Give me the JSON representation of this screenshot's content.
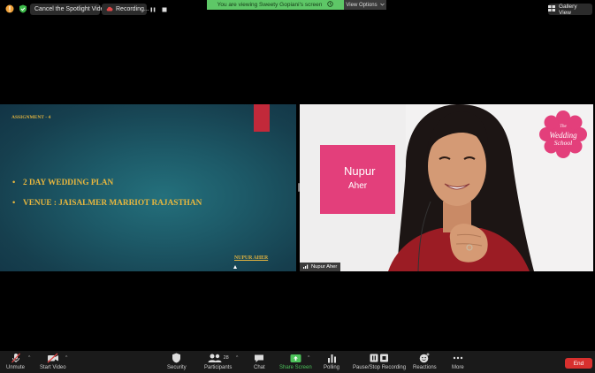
{
  "topbar": {
    "spotlight_label": "Cancel the Spotlight Video",
    "recording_label": "Recording...",
    "viewing_banner": "You are viewing Sweety Gopiani's screen",
    "view_options": "View Options",
    "gallery_view": "Gallery View"
  },
  "slide": {
    "heading": "ASSIGNMENT - 4",
    "bullet1": "2 DAY WEDDING PLAN",
    "bullet2": "VENUE : JAISALMER MARRIOT RAJASTHAN",
    "author": "NUPUR AHER",
    "bullet_symbol": "•"
  },
  "video": {
    "first_name": "Nupur",
    "last_name": "Aher",
    "logo_line1": "The",
    "logo_line2": "Wedding",
    "logo_line3": "School",
    "participant_name": "Nupur Aher"
  },
  "toolbar": {
    "unmute": "Unmute",
    "start_video": "Start Video",
    "security": "Security",
    "participants": "Participants",
    "participants_count": "28",
    "chat": "Chat",
    "share_screen": "Share Screen",
    "polling": "Polling",
    "recording": "Pause/Stop Recording",
    "reactions": "Reactions",
    "more": "More",
    "end": "End"
  },
  "colors": {
    "banner_green": "#5ec767",
    "slide_text_gold": "#e8b73e",
    "pink": "#e33f7b",
    "end_red": "#d8302e",
    "share_green": "#4cc25a"
  }
}
